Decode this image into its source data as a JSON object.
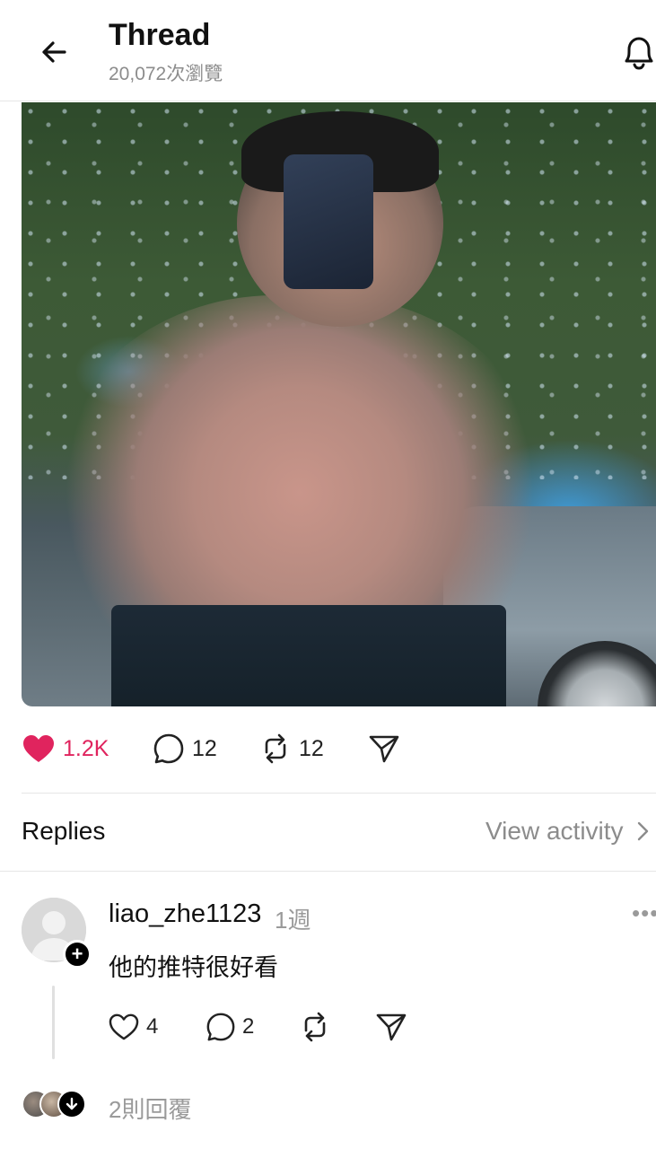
{
  "header": {
    "title": "Thread",
    "views": "20,072次瀏覽"
  },
  "post": {
    "stats": {
      "likes": "1.2K",
      "comments": "12",
      "reposts": "12"
    },
    "liked": true
  },
  "replies_section": {
    "label": "Replies",
    "view_activity": "View activity"
  },
  "reply": {
    "username": "liao_zhe1123",
    "time": "1週",
    "text": "他的推特很好看",
    "likes": "4",
    "comments": "2",
    "more": "•••"
  },
  "reply_summary": {
    "text": "2則回覆"
  },
  "colors": {
    "like": "#e0245e",
    "muted": "#8c8c8c",
    "divider": "#e6e6e6"
  }
}
